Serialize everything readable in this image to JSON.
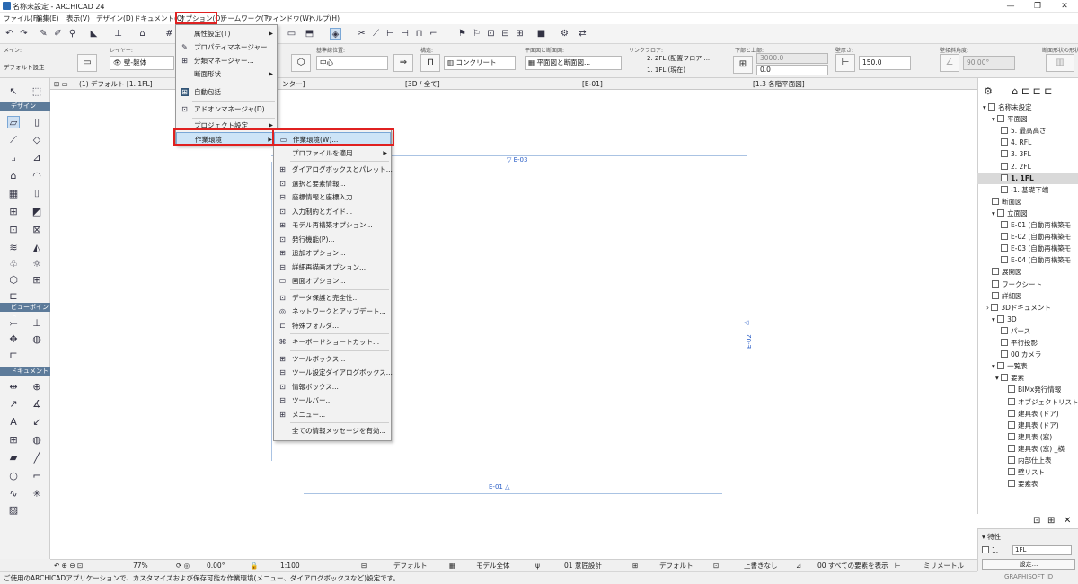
{
  "window": {
    "title": "名称未設定 - ARCHICAD 24",
    "minimize": "—",
    "maximize": "❐",
    "close": "✕"
  },
  "menubar": {
    "items": [
      "ファイル(F)",
      "編集(E)",
      "表示(V)",
      "デザイン(D)",
      "ドキュメント(C)",
      "オプション(O)",
      "チームワーク(T)",
      "ウィンドウ(W)",
      "ヘルプ(H)"
    ]
  },
  "infobox": {
    "main_label": "メイン:",
    "default_setting": "デフォルト設定",
    "layer_label": "レイヤー:",
    "layer_value": "壁-躯体",
    "ref_label": "基準線位置:",
    "ref_value": "中心",
    "struct_label": "構造:",
    "struct_value": "コンクリート",
    "plan_label": "平面図と断面図:",
    "plan_value": "平面図と断面図...",
    "link_label": "リンクフロア:",
    "link_top": "2. 2FL (配置フロア ...",
    "link_bottom": "1. 1FL (現在)",
    "topbot_label": "下部と上部:",
    "top_value": "3000.0",
    "bottom_value": "0.0",
    "thick_label": "壁厚さ:",
    "thick_value": "150.0",
    "angle_label": "壁傾斜角度:",
    "angle_value": "90.00°",
    "shape_label": "断面形状の形状"
  },
  "tabs": [
    "(1) デフォルト [1. 1FL]",
    "[3D / 全て]",
    "[E-01]",
    "[1.3 各階平面図]"
  ],
  "tab_partial": "ンター]",
  "toolbox": {
    "sections": [
      "デザイン",
      "ビューポイント",
      "ドキュメント"
    ]
  },
  "canvas": {
    "markers": [
      "E-03",
      "E-02",
      "E-01"
    ]
  },
  "navigator": {
    "rows": [
      "名称未設定",
      "平面図",
      "5. 最高高さ",
      "4. RFL",
      "3. 3FL",
      "2. 2FL",
      "1. 1FL",
      "-1. 基礎下端",
      "断面図",
      "立面図",
      "E-01 (自動再構築モ",
      "E-02 (自動再構築モ",
      "E-03 (自動再構築モ",
      "E-04 (自動再構築モ",
      "展開図",
      "ワークシート",
      "詳細図",
      "3Dドキュメント",
      "3D",
      "パース",
      "平行投影",
      "00 カメラ",
      "一覧表",
      "要素",
      "BIMx発行情報",
      "オブジェクトリスト",
      "建具表 (ドア)",
      "建具表 (ドア)",
      "建具表 (窓)",
      "建具表 (窓) _横",
      "内部仕上表",
      "壁リスト",
      "要素表"
    ],
    "properties_header": "特性",
    "prop_id": "1.",
    "prop_value": "1FL",
    "settings_button": "設定...",
    "brand": "GRAPHISOFT ID"
  },
  "statusbar": {
    "zoom": "77%",
    "angle": "0.00°",
    "scale": "1:100",
    "layer_combo": "デフォルト",
    "model_view": "モデル全体",
    "pen_set": "01 意匠設計",
    "dim": "デフォルト",
    "override": "上書きなし",
    "renovation": "00 すべての要素を表示",
    "unit": "ミリメートル",
    "message": "ご使用のARCHICADアプリケーションで、カスタマイズおよび保存可能な作業環境(メニュー、ダイアログボックスなど)設定です。"
  },
  "options_menu": {
    "items": [
      "属性設定(T)",
      "プロパティマネージャー...",
      "分類マネージャー...",
      "断面形状",
      "自動包括",
      "アドオンマネージャ(D)...",
      "プロジェクト設定",
      "作業環境"
    ]
  },
  "work_env_menu": {
    "items": [
      "作業環境(W)...",
      "プロファイルを適用",
      "ダイアログボックスとパレット...",
      "選択と要素情報...",
      "座標情報と座標入力...",
      "入力制約とガイド...",
      "モデル再構築オプション...",
      "発行機能(P)...",
      "追加オプション...",
      "詳細再描画オプション...",
      "画面オプション...",
      "データ保護と完全性...",
      "ネットワークとアップデート...",
      "特殊フォルダ...",
      "キーボードショートカット...",
      "ツールボックス...",
      "ツール設定ダイアログボックス...",
      "情報ボックス...",
      "ツールバー...",
      "メニュー...",
      "全ての情報メッセージを有効..."
    ]
  },
  "colors": {
    "highlight_red": "#e02020",
    "menu_highlight": "#cde4f7",
    "marker_blue": "#2a5ec7",
    "section_header": "#5d7b9a"
  }
}
